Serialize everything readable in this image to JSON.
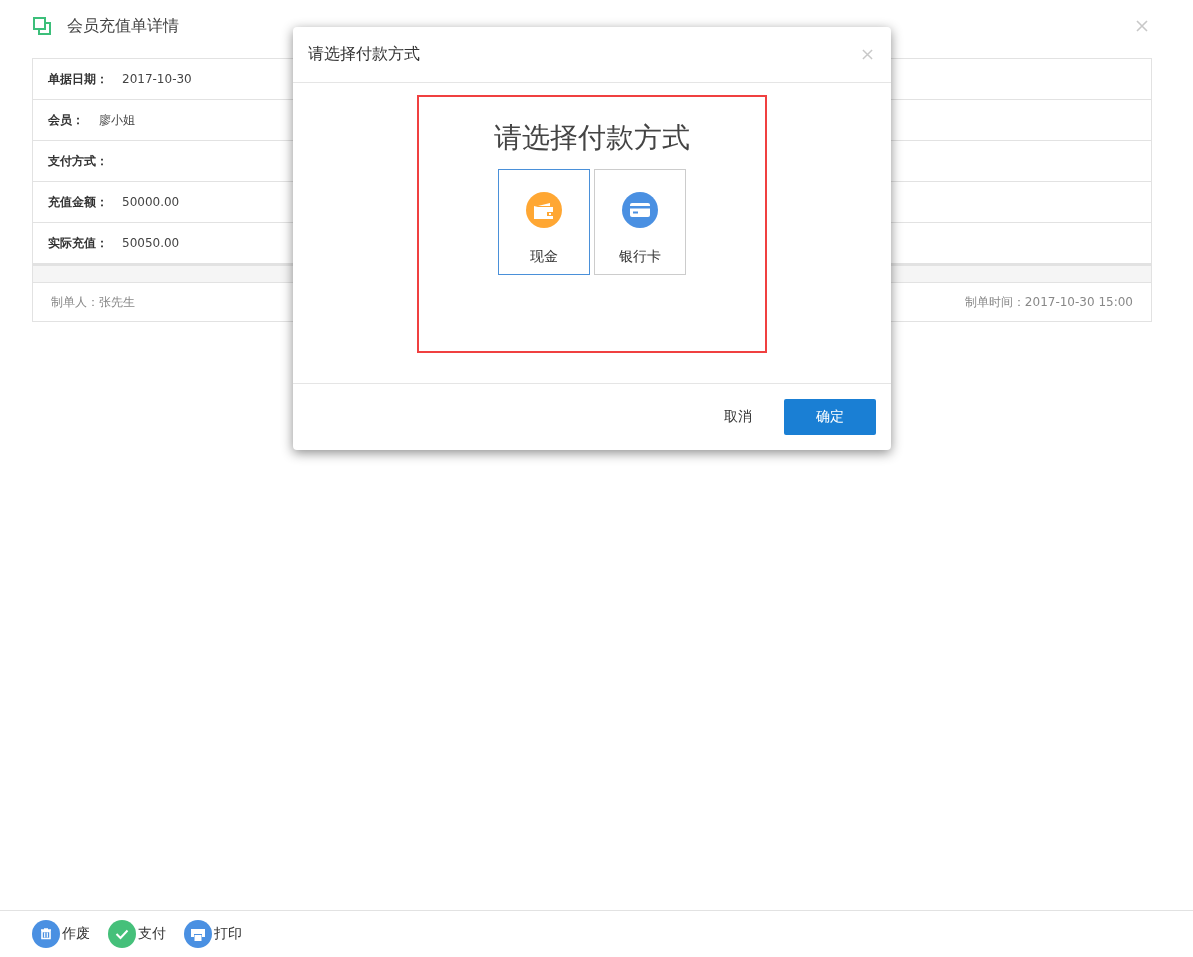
{
  "page": {
    "title": "会员充值单详情"
  },
  "details": [
    {
      "label": "单据日期：",
      "value": "2017-10-30"
    },
    {
      "label": "会员：",
      "value": "廖小姐"
    },
    {
      "label": "支付方式："
    },
    {
      "label": "充值金额：",
      "value": "50000.00"
    },
    {
      "label": "实际充值：",
      "value": "50050.00"
    }
  ],
  "footer": {
    "creator": "制单人：张先生",
    "created_time": "制单时间：2017-10-30 15:00"
  },
  "actions": [
    {
      "kind": "void",
      "label": "作废"
    },
    {
      "kind": "pay",
      "label": "支付"
    },
    {
      "kind": "print",
      "label": "打印"
    }
  ],
  "dialog": {
    "title": "请选择付款方式",
    "heading": "请选择付款方式",
    "options": [
      {
        "kind": "cash",
        "label": "现金",
        "selected": true
      },
      {
        "kind": "card",
        "label": "银行卡",
        "selected": false
      }
    ],
    "cancel": "取消",
    "confirm": "确定"
  }
}
